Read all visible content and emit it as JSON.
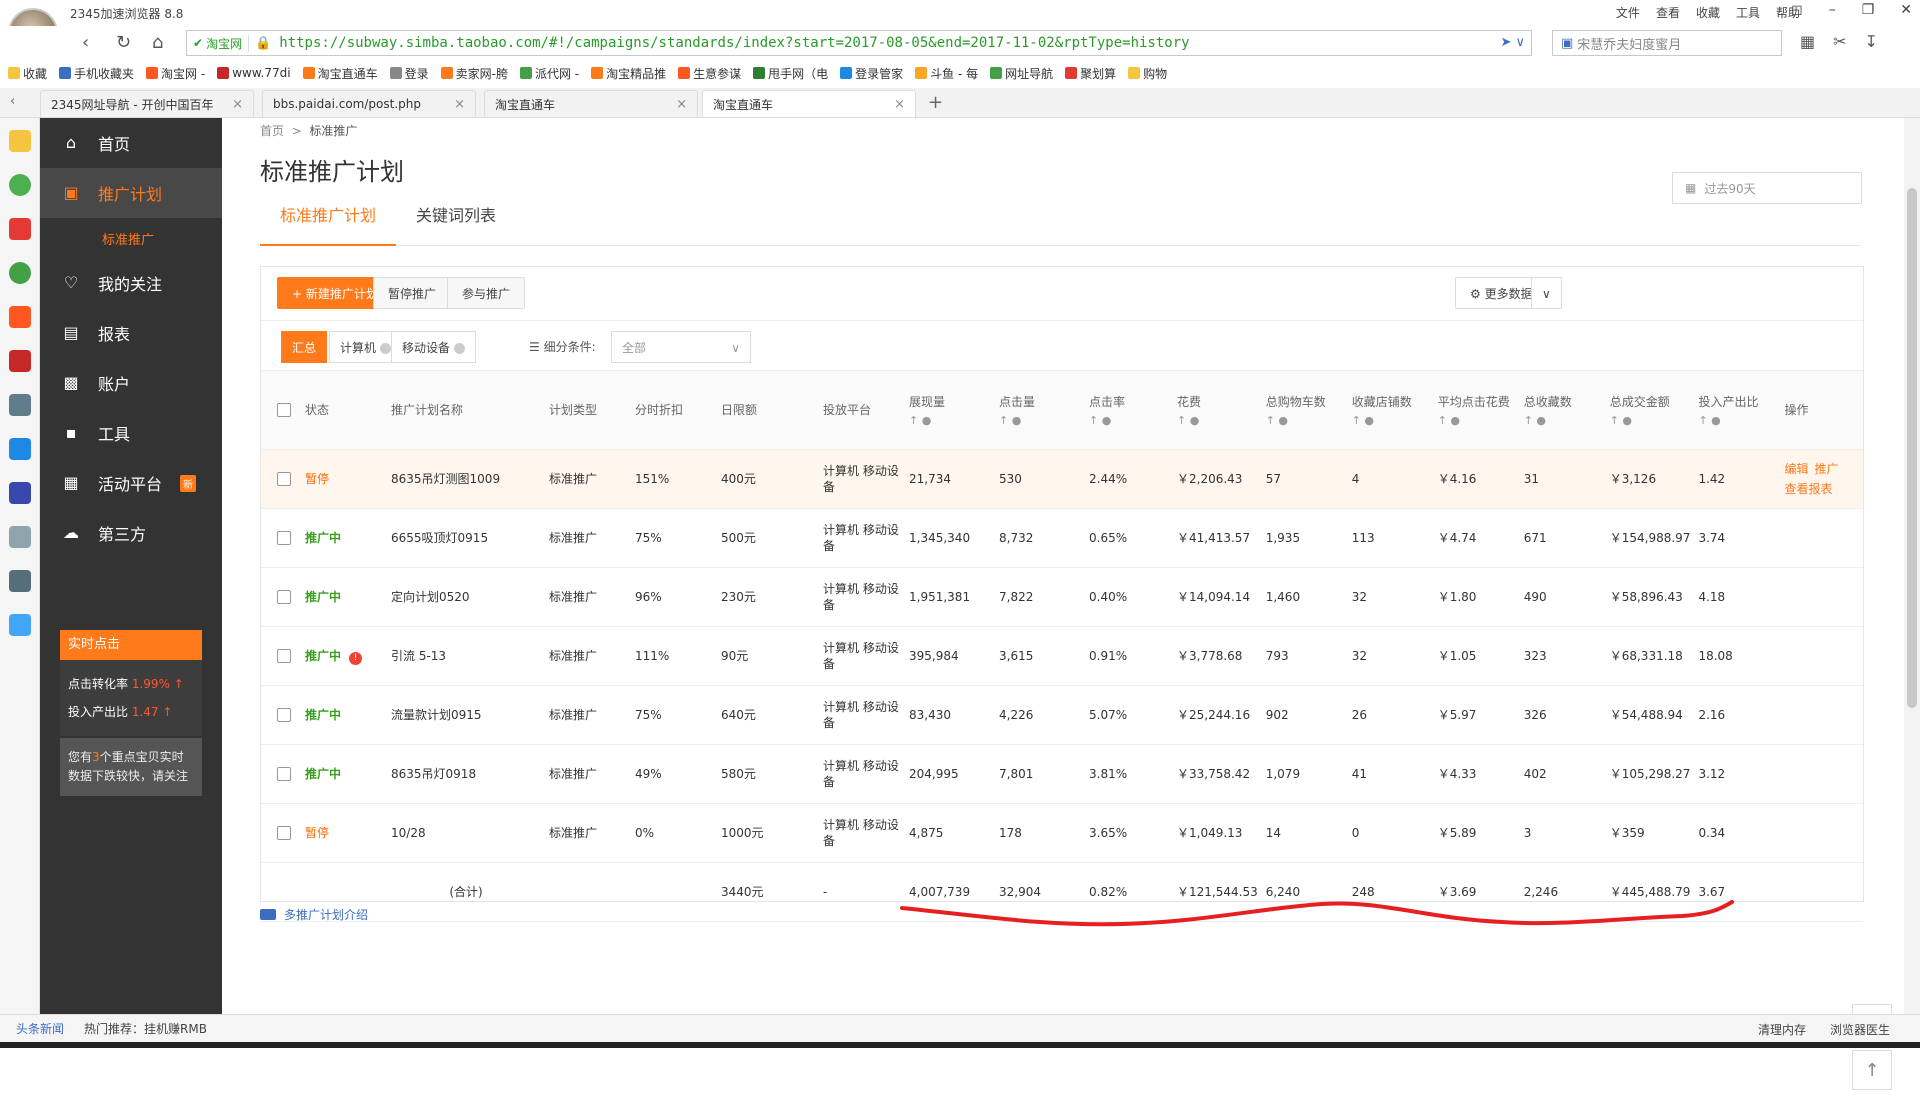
{
  "browser": {
    "title": "2345加速浏览器 8.8",
    "menu": [
      "文件",
      "查看",
      "收藏",
      "工具",
      "帮助"
    ],
    "secure_label": "淘宝网",
    "url": "https://subway.simba.taobao.com/#!/campaigns/standards/index?start=2017-08-05&end=2017-11-02&rptType=history",
    "search_placeholder": "宋慧乔夫妇度蜜月",
    "bookmarks": [
      "收藏",
      "手机收藏夹",
      "淘宝网 -",
      "www.77di",
      "淘宝直通车",
      "登录",
      "卖家网-胯",
      "派代网 -",
      "淘宝精品推",
      "生意参谋",
      "甩手网（电",
      "登录管家",
      "斗鱼 - 每",
      "网址导航",
      "聚划算",
      "购物"
    ],
    "tabs": [
      {
        "label": "2345网址导航 - 开创中国百年",
        "active": false
      },
      {
        "label": "bbs.paidai.com/post.php",
        "active": false
      },
      {
        "label": "淘宝直通车",
        "active": false
      },
      {
        "label": "淘宝直通车",
        "active": true
      }
    ]
  },
  "sidebar": {
    "items": [
      {
        "label": "首页",
        "icon": "home-icon"
      },
      {
        "label": "推广计划",
        "icon": "briefcase-icon",
        "active": true
      },
      {
        "label": "我的关注",
        "icon": "heart-icon"
      },
      {
        "label": "报表",
        "icon": "report-icon"
      },
      {
        "label": "账户",
        "icon": "account-icon"
      },
      {
        "label": "工具",
        "icon": "toolbox-icon"
      },
      {
        "label": "活动平台",
        "icon": "gift-icon",
        "badge": "新"
      },
      {
        "label": "第三方",
        "icon": "cloud-icon"
      }
    ],
    "sub_item": "标准推广",
    "realtime": {
      "title": "实时点击",
      "conv_label": "点击转化率",
      "conv_value": "1.99%",
      "roi_label": "投入产出比",
      "roi_value": "1.47",
      "note_prefix": "您有",
      "note_count": "3",
      "note_suffix": "个重点宝贝实时数据下跌较快，请关注"
    }
  },
  "main": {
    "breadcrumb": [
      "首页",
      "标准推广"
    ],
    "title": "标准推广计划",
    "date_range": "过去90天",
    "subtabs": [
      "标准推广计划",
      "关键词列表"
    ],
    "buttons": {
      "new_plan": "+ 新建推广计划",
      "pause": "暂停推广",
      "join": "参与推广",
      "more_data": "更多数据"
    },
    "filters": {
      "summary": "汇总",
      "pc": "计算机",
      "mobile": "移动设备",
      "cond_label": "细分条件:",
      "cond_value": "全部"
    },
    "columns": [
      "状态",
      "推广计划名称",
      "计划类型",
      "分时折扣",
      "日限额",
      "投放平台",
      "展现量",
      "点击量",
      "点击率",
      "花费",
      "总购物车数",
      "收藏店铺数",
      "平均点击花费",
      "总收藏数",
      "总成交金额",
      "投入产出比",
      "操作"
    ],
    "rows": [
      {
        "status": "暂停",
        "name": "8635吊灯测图1009",
        "type": "标准推广",
        "discount": "151%",
        "limit": "400元",
        "platform": "计算机 移动设备",
        "impressions": "21,734",
        "clicks": "530",
        "ctr": "2.44%",
        "cost": "￥2,206.43",
        "cart": "57",
        "fav_shop": "4",
        "cpc": "￥4.16",
        "fav": "31",
        "gmv": "￥3,126",
        "roi": "1.42",
        "ops": [
          "编辑",
          "推广",
          "查看报表"
        ]
      },
      {
        "status": "推广中",
        "name": "6655吸顶灯0915",
        "type": "标准推广",
        "discount": "75%",
        "limit": "500元",
        "platform": "计算机 移动设备",
        "impressions": "1,345,340",
        "clicks": "8,732",
        "ctr": "0.65%",
        "cost": "￥41,413.57",
        "cart": "1,935",
        "fav_shop": "113",
        "cpc": "￥4.74",
        "fav": "671",
        "gmv": "￥154,988.97",
        "roi": "3.74"
      },
      {
        "status": "推广中",
        "name": "定向计划0520",
        "type": "标准推广",
        "discount": "96%",
        "limit": "230元",
        "platform": "计算机 移动设备",
        "impressions": "1,951,381",
        "clicks": "7,822",
        "ctr": "0.40%",
        "cost": "￥14,094.14",
        "cart": "1,460",
        "fav_shop": "32",
        "cpc": "￥1.80",
        "fav": "490",
        "gmv": "￥58,896.43",
        "roi": "4.18"
      },
      {
        "status": "推广中",
        "name": "引流 5-13",
        "type": "标准推广",
        "discount": "111%",
        "limit": "90元",
        "platform": "计算机 移动设备",
        "impressions": "395,984",
        "clicks": "3,615",
        "ctr": "0.91%",
        "cost": "￥3,778.68",
        "cart": "793",
        "fav_shop": "32",
        "cpc": "￥1.05",
        "fav": "323",
        "gmv": "￥68,331.18",
        "roi": "18.08",
        "warn": true
      },
      {
        "status": "推广中",
        "name": "流量款计划0915",
        "type": "标准推广",
        "discount": "75%",
        "limit": "640元",
        "platform": "计算机 移动设备",
        "impressions": "83,430",
        "clicks": "4,226",
        "ctr": "5.07%",
        "cost": "￥25,244.16",
        "cart": "902",
        "fav_shop": "26",
        "cpc": "￥5.97",
        "fav": "326",
        "gmv": "￥54,488.94",
        "roi": "2.16"
      },
      {
        "status": "推广中",
        "name": "8635吊灯0918",
        "type": "标准推广",
        "discount": "49%",
        "limit": "580元",
        "platform": "计算机 移动设备",
        "impressions": "204,995",
        "clicks": "7,801",
        "ctr": "3.81%",
        "cost": "￥33,758.42",
        "cart": "1,079",
        "fav_shop": "41",
        "cpc": "￥4.33",
        "fav": "402",
        "gmv": "￥105,298.27",
        "roi": "3.12"
      },
      {
        "status": "暂停",
        "name": "10/28",
        "type": "标准推广",
        "discount": "0%",
        "limit": "1000元",
        "platform": "计算机 移动设备",
        "impressions": "4,875",
        "clicks": "178",
        "ctr": "3.65%",
        "cost": "￥1,049.13",
        "cart": "14",
        "fav_shop": "0",
        "cpc": "￥5.89",
        "fav": "3",
        "gmv": "￥359",
        "roi": "0.34"
      }
    ],
    "total": {
      "label": "(合计)",
      "limit": "3440元",
      "platform": "-",
      "impressions": "4,007,739",
      "clicks": "32,904",
      "ctr": "0.82%",
      "cost": "￥121,544.53",
      "cart": "6,240",
      "fav_shop": "248",
      "cpc": "￥3.69",
      "fav": "2,246",
      "gmv": "￥445,488.79",
      "roi": "3.67"
    },
    "intro_link": "多推广计划介绍"
  },
  "statusbar": {
    "news": "头条新闻",
    "hot": "热门推荐：挂机赚RMB",
    "right": [
      "清理内存",
      "浏览器医生"
    ]
  }
}
